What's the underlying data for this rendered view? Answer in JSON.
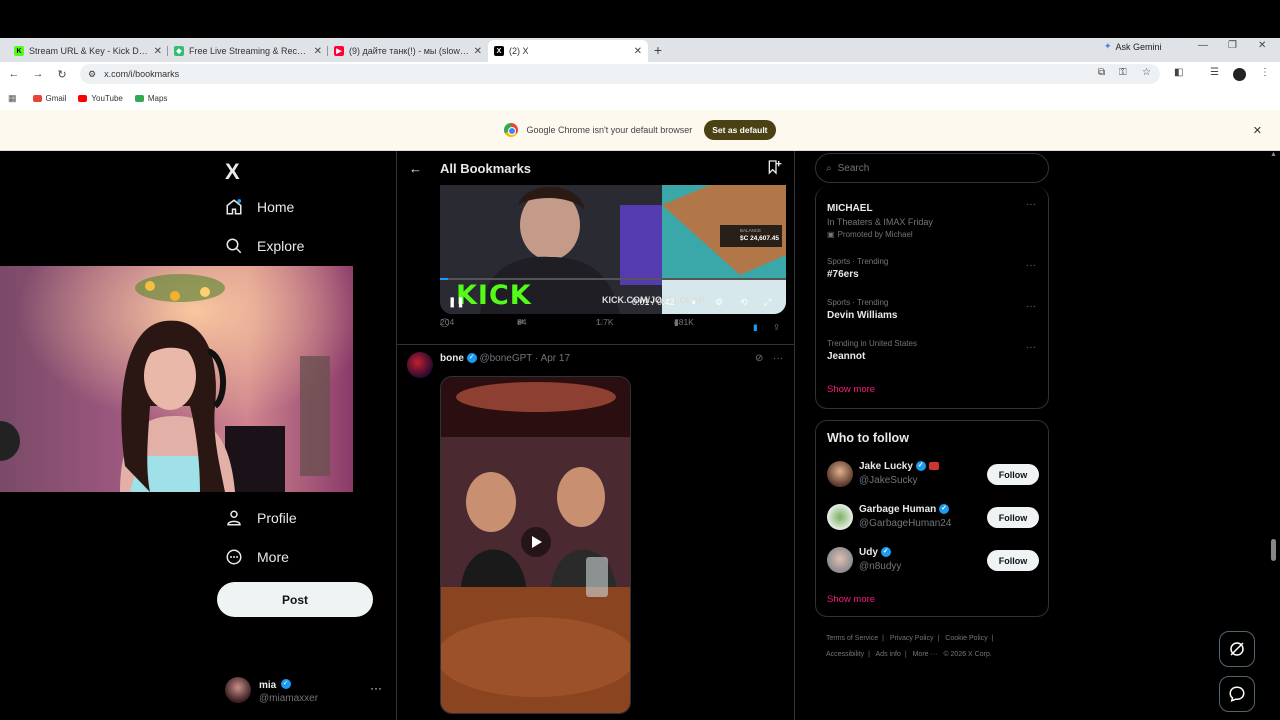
{
  "browser": {
    "tabs": [
      {
        "title": "Stream URL & Key - Kick Dashb",
        "icon_color": "#53fc18",
        "icon_glyph": "K"
      },
      {
        "title": "Free Live Streaming & Recordin",
        "icon_color": "#2fbf71",
        "icon_glyph": "◆"
      },
      {
        "title": "(9) дайте танк(!) - мы (slowed +",
        "icon_color": "#ff0033",
        "icon_glyph": "▶"
      },
      {
        "title": "(2) X",
        "icon_color": "#000000",
        "icon_glyph": "X"
      }
    ],
    "ask_gemini": "Ask Gemini",
    "url": "x.com/i/bookmarks",
    "bookmarks": [
      {
        "label": "Gmail",
        "color": "#ea4335"
      },
      {
        "label": "YouTube",
        "color": "#ff0000"
      },
      {
        "label": "Maps",
        "color": "#34a853"
      }
    ],
    "infobar_text": "Google Chrome isn't your default browser",
    "infobar_button": "Set as default"
  },
  "x": {
    "logo": "X",
    "nav": {
      "home": "Home",
      "explore": "Explore",
      "profile": "Profile",
      "more": "More"
    },
    "post_button": "Post",
    "account": {
      "name": "mia",
      "handle": "@miamaxxer"
    },
    "header_title": "All Bookmarks",
    "video1": {
      "brand": "KICK",
      "time": "0:01 / 0:42",
      "watermark": "KICK.COM/JOESLOLAR",
      "balance_label": "BALANCE",
      "balance": "$C 24,607.45"
    },
    "tweet1_actions": {
      "replies": "204",
      "reposts": "84",
      "likes": "1.7K",
      "views": "481K"
    },
    "tweet2": {
      "name": "bone",
      "handle": "@boneGPT",
      "date": "· Apr 17"
    },
    "search_placeholder": "Search",
    "trends": [
      {
        "title": "MICHAEL",
        "sub": "In Theaters & IMAX Friday",
        "promo": "Promoted by Michael"
      },
      {
        "context": "Sports · Trending",
        "title": "#76ers"
      },
      {
        "context": "Sports · Trending",
        "title": "Devin Williams"
      },
      {
        "context": "Trending in United States",
        "title": "Jeannot"
      }
    ],
    "show_more": "Show more",
    "who_to_follow": "Who to follow",
    "follow_label": "Follow",
    "people": [
      {
        "name": "Jake Lucky",
        "handle": "@JakeSucky"
      },
      {
        "name": "Garbage Human",
        "handle": "@GarbageHuman24"
      },
      {
        "name": "Udy",
        "handle": "@n8udyy"
      }
    ],
    "footer": [
      "Terms of Service",
      "|",
      "Privacy Policy",
      "|",
      "Cookie Policy",
      "|",
      "Accessibility",
      "|",
      "Ads info",
      "|",
      "More ···",
      "© 2026 X Corp."
    ]
  }
}
